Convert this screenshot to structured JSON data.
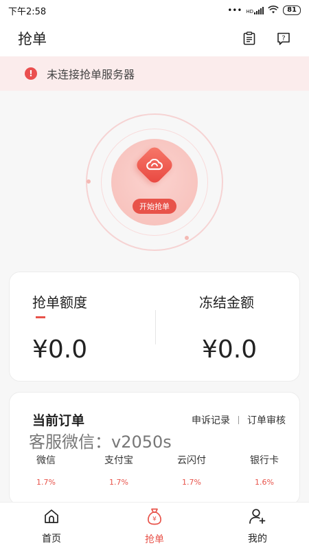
{
  "status_bar": {
    "time": "下午2:58",
    "network": "HD",
    "battery": "81"
  },
  "header": {
    "title": "抢单"
  },
  "notice": {
    "text": "未连接抢单服务器"
  },
  "radar": {
    "start_label": "开始抢单"
  },
  "balance": {
    "quota_label": "抢单额度",
    "quota_value": "¥0.0",
    "frozen_label": "冻结金额",
    "frozen_value": "¥0.0"
  },
  "orders": {
    "title": "当前订单",
    "appeal_link": "申诉记录",
    "review_link": "订单审核",
    "watermark": "客服微信：v2050s",
    "rates": [
      {
        "name": "微信",
        "value": "1.7%"
      },
      {
        "name": "支付宝",
        "value": "1.7%"
      },
      {
        "name": "云闪付",
        "value": "1.7%"
      },
      {
        "name": "银行卡",
        "value": "1.6%"
      }
    ]
  },
  "nav": {
    "items": [
      {
        "label": "首页",
        "icon": "home-icon"
      },
      {
        "label": "抢单",
        "icon": "money-bag-icon"
      },
      {
        "label": "我的",
        "icon": "add-user-icon"
      }
    ],
    "active": "抢单"
  },
  "colors": {
    "accent": "#e8534a",
    "notice_bg": "#fbecec",
    "page_bg": "#f7f7f7"
  }
}
